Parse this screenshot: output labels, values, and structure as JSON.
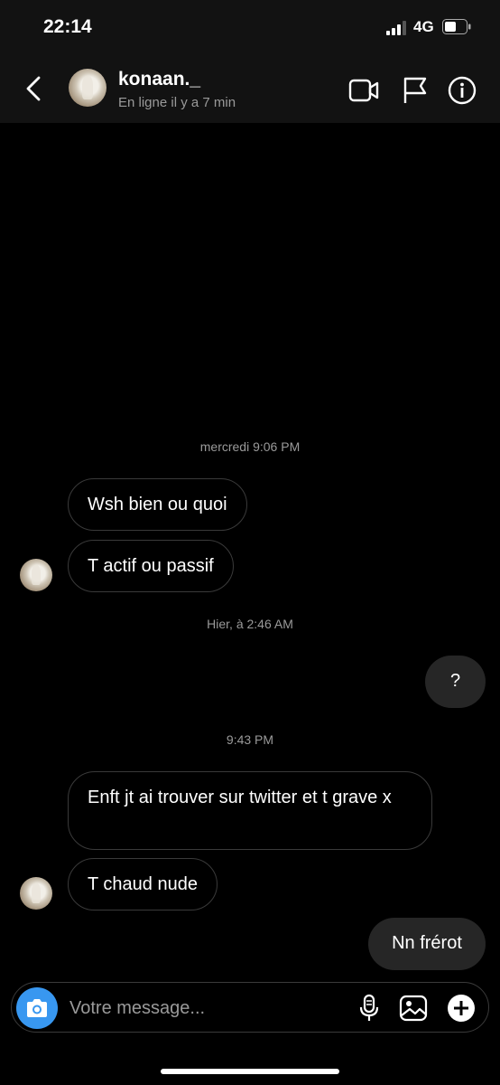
{
  "status_bar": {
    "time": "22:14",
    "network": "4G"
  },
  "header": {
    "username": "konaan._",
    "status": "En ligne il y a 7 min"
  },
  "timestamps": [
    "mercredi 9:06 PM",
    "Hier, à 2:46 AM",
    "9:43 PM"
  ],
  "messages": [
    {
      "text": "Wsh bien ou quoi",
      "direction": "incoming"
    },
    {
      "text": "T actif ou passif",
      "direction": "incoming"
    },
    {
      "text": "?",
      "direction": "outgoing"
    },
    {
      "text": "Enft jt ai trouver sur twitter et t grave x",
      "direction": "incoming"
    },
    {
      "text": "T chaud nude",
      "direction": "incoming"
    },
    {
      "text": "Nn frérot",
      "direction": "outgoing"
    }
  ],
  "composer": {
    "placeholder": "Votre message..."
  },
  "colors": {
    "accent": "#3897f0",
    "background": "#000000",
    "outgoing_bubble": "#262626"
  }
}
